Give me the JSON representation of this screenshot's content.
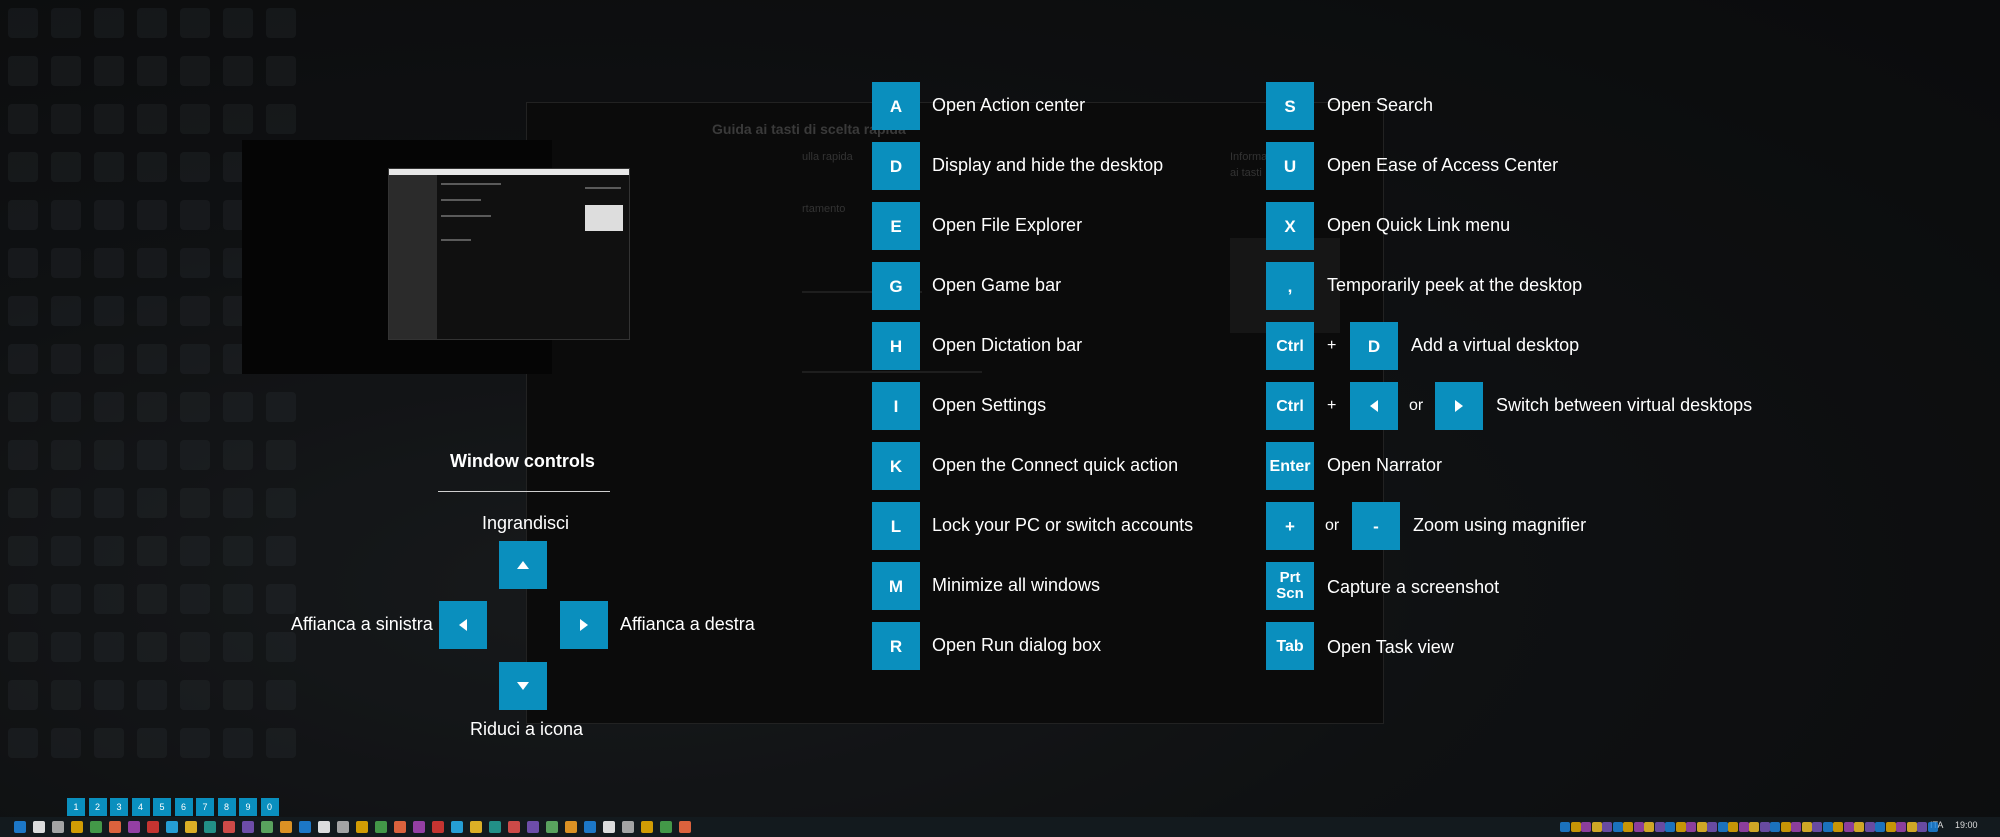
{
  "keyboard_shortcuts_left": [
    {
      "key": "A",
      "label": "Open Action center"
    },
    {
      "key": "D",
      "label": "Display and hide the desktop"
    },
    {
      "key": "E",
      "label": "Open File Explorer"
    },
    {
      "key": "G",
      "label": "Open Game bar"
    },
    {
      "key": "H",
      "label": "Open Dictation bar"
    },
    {
      "key": "I",
      "label": "Open Settings"
    },
    {
      "key": "K",
      "label": "Open the Connect quick action"
    },
    {
      "key": "L",
      "label": "Lock your PC or switch accounts"
    },
    {
      "key": "M",
      "label": "Minimize all windows"
    },
    {
      "key": "R",
      "label": "Open Run dialog box"
    }
  ],
  "keyboard_shortcuts_right": {
    "s": {
      "key": "S",
      "label": "Open Search"
    },
    "u": {
      "key": "U",
      "label": "Open Ease of Access Center"
    },
    "x": {
      "key": "X",
      "label": "Open Quick Link menu"
    },
    "comma": {
      "key": ",",
      "label": "Temporarily peek at the desktop"
    },
    "ctrl_d": {
      "key1": "Ctrl",
      "plus": "+",
      "key2": "D",
      "label": "Add a virtual desktop"
    },
    "ctrl_arrows": {
      "key1": "Ctrl",
      "plus": "+",
      "or": "or",
      "label": "Switch between virtual desktops"
    },
    "enter": {
      "key": "Enter",
      "label": "Open Narrator"
    },
    "zoom": {
      "key1": "+",
      "or": "or",
      "key2": "-",
      "label": "Zoom using magnifier"
    },
    "prtscn": {
      "key_line1": "Prt",
      "key_line2": "Scn",
      "label": "Capture a screenshot"
    },
    "tab": {
      "key": "Tab",
      "label": "Open Task view"
    }
  },
  "window_controls": {
    "title": "Window controls",
    "up_label": "Ingrandisci",
    "left_label": "Affianca a sinistra",
    "right_label": "Affianca a destra",
    "down_label": "Riduci a icona"
  },
  "background_window": {
    "title": "Guida ai tasti di scelta rapida",
    "text_1": "ulla rapida",
    "text_2": "rtamento",
    "text_3": "Informazioni",
    "text_4": "ai tasti"
  },
  "desktop_numbers": [
    "1",
    "2",
    "3",
    "4",
    "5",
    "6",
    "7",
    "8",
    "9",
    "0"
  ],
  "taskbar": {
    "clock": "19:00",
    "lang": "ITA"
  },
  "colors": {
    "key_accent": "#0a8fbe"
  }
}
